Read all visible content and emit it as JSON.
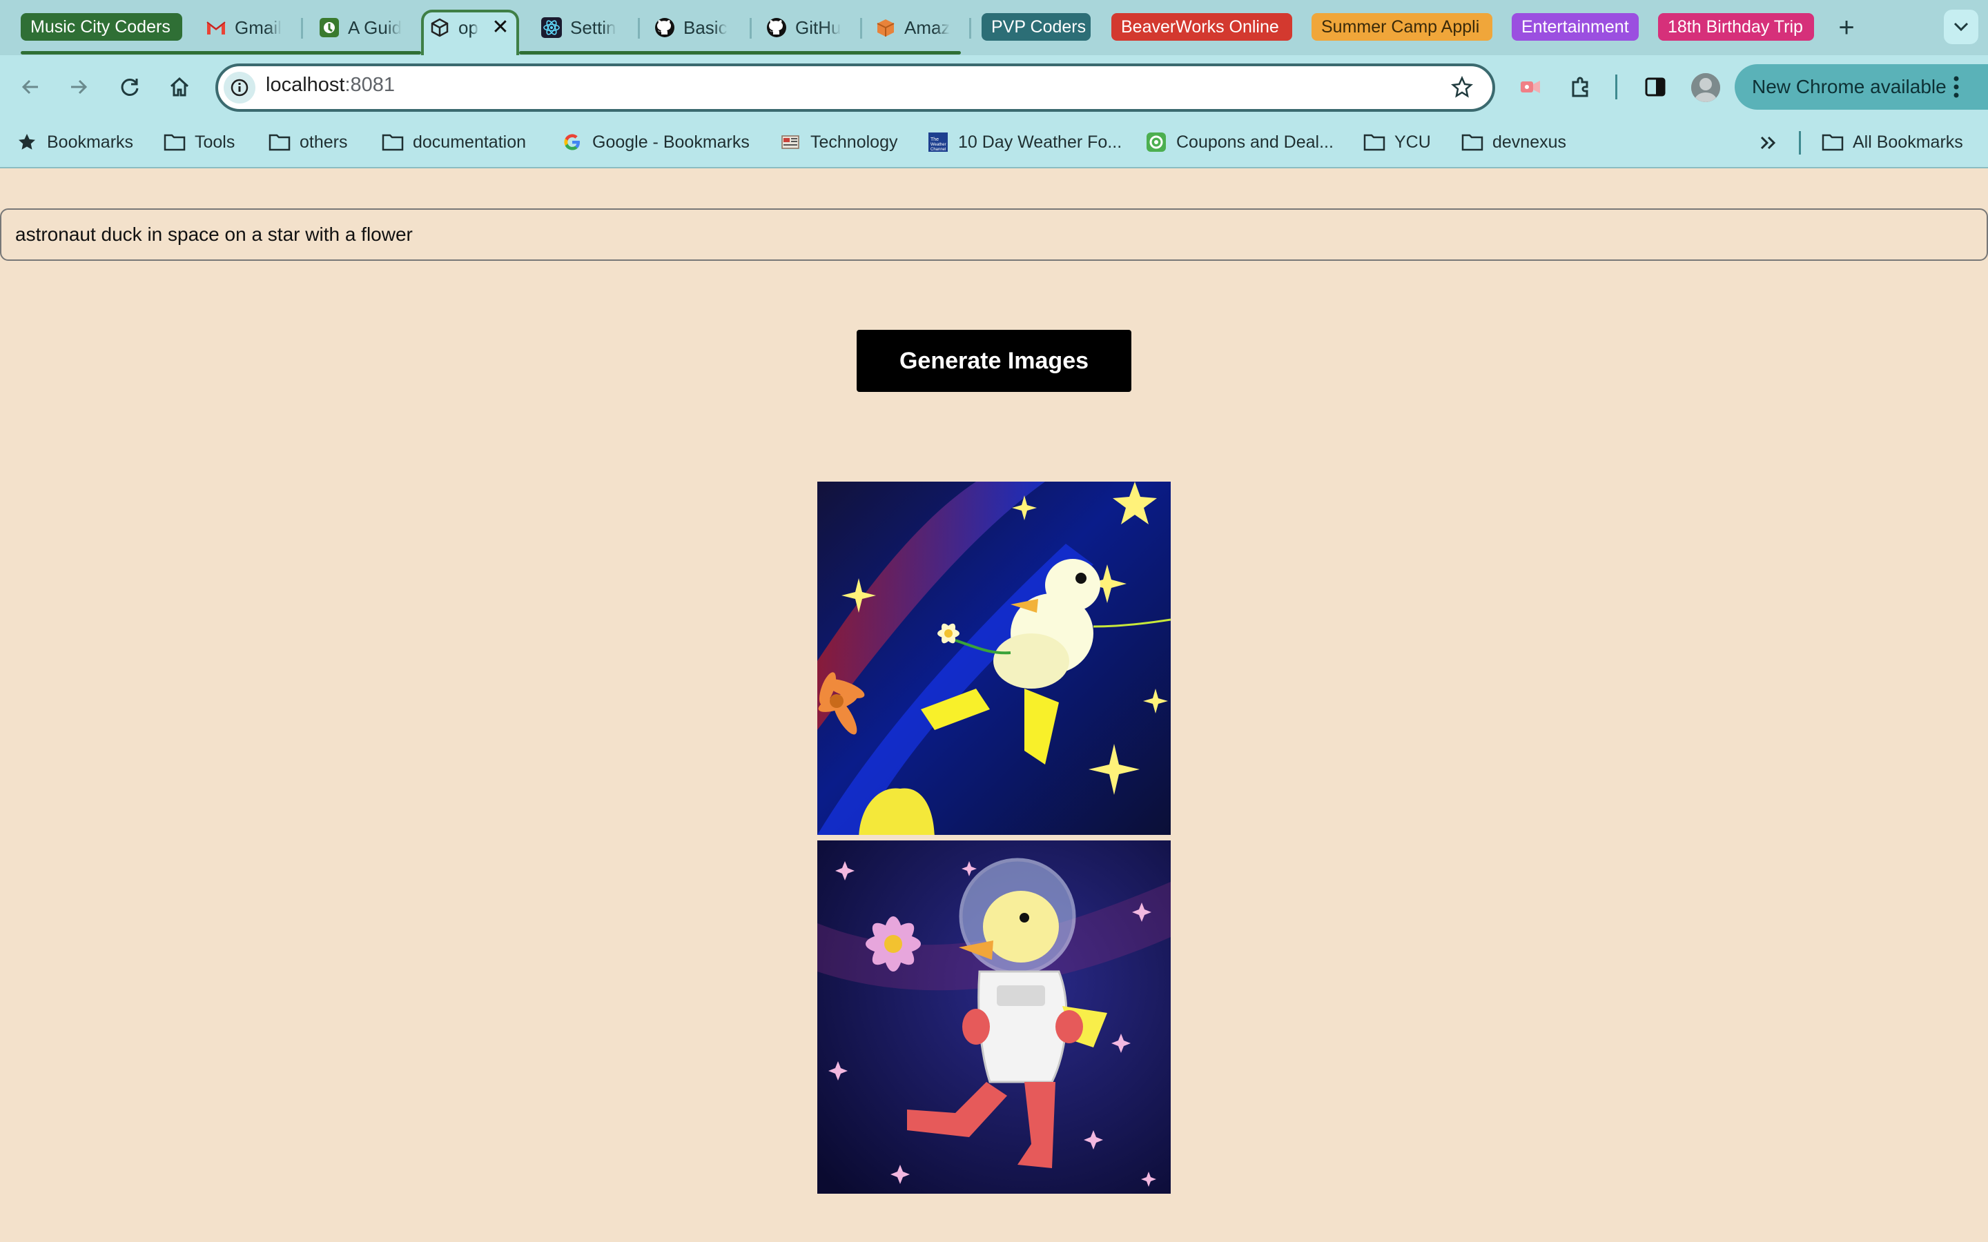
{
  "browser": {
    "tab_groups": [
      {
        "label": "Music City Coders",
        "color": "#2f6f35"
      },
      {
        "label": "PVP Coders",
        "color": "#2c6e76"
      },
      {
        "label": "BeaverWorks Online",
        "color": "#d3392f"
      },
      {
        "label": "Summer Camp Appli",
        "color": "#f0a63a"
      },
      {
        "label": "Entertainment",
        "color": "#9b4fe0"
      },
      {
        "label": "18th Birthday Trip",
        "color": "#d6307a"
      }
    ],
    "tabs": [
      {
        "title": "Gmail",
        "icon": "gmail-icon"
      },
      {
        "title": "A Guid",
        "icon": "guide-site-icon"
      },
      {
        "title": "op",
        "icon": "open-box-icon",
        "active": true
      },
      {
        "title": "Settin",
        "icon": "react-icon"
      },
      {
        "title": "Basic",
        "icon": "github-icon"
      },
      {
        "title": "GitHu",
        "icon": "github-icon"
      },
      {
        "title": "Amaz",
        "icon": "amazon-box-icon"
      }
    ],
    "address_bar": {
      "host": "localhost",
      "port": ":8081"
    },
    "update_button": "New Chrome available",
    "bookmarks": [
      {
        "label": "Bookmarks",
        "icon": "star-icon"
      },
      {
        "label": "Tools",
        "icon": "folder-icon"
      },
      {
        "label": "others",
        "icon": "folder-icon"
      },
      {
        "label": "documentation",
        "icon": "folder-icon"
      },
      {
        "label": "Google - Bookmarks",
        "icon": "google-icon"
      },
      {
        "label": "Technology",
        "icon": "technology-icon"
      },
      {
        "label": "10 Day Weather Fo...",
        "icon": "weather-channel-icon"
      },
      {
        "label": "Coupons and Deal...",
        "icon": "coupon-icon"
      },
      {
        "label": "YCU",
        "icon": "folder-icon"
      },
      {
        "label": "devnexus",
        "icon": "folder-icon"
      }
    ],
    "all_bookmarks": "All Bookmarks"
  },
  "page": {
    "prompt_value": "astronaut duck in space on a star with a flower",
    "generate_label": "Generate Images",
    "images": [
      {
        "subject": "duck floating in space holding a flower with stars"
      },
      {
        "subject": "duck in astronaut suit walking among stars with a pink flower"
      }
    ]
  }
}
